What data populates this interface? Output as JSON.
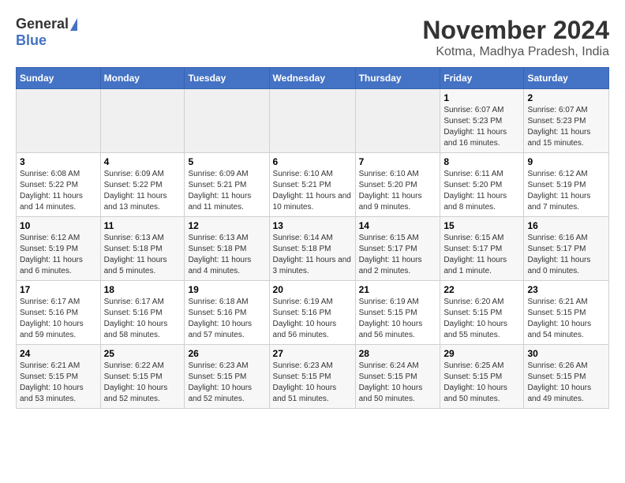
{
  "logo": {
    "general": "General",
    "blue": "Blue"
  },
  "title": "November 2024",
  "subtitle": "Kotma, Madhya Pradesh, India",
  "days_of_week": [
    "Sunday",
    "Monday",
    "Tuesday",
    "Wednesday",
    "Thursday",
    "Friday",
    "Saturday"
  ],
  "weeks": [
    [
      {
        "day": "",
        "info": ""
      },
      {
        "day": "",
        "info": ""
      },
      {
        "day": "",
        "info": ""
      },
      {
        "day": "",
        "info": ""
      },
      {
        "day": "",
        "info": ""
      },
      {
        "day": "1",
        "info": "Sunrise: 6:07 AM\nSunset: 5:23 PM\nDaylight: 11 hours and 16 minutes."
      },
      {
        "day": "2",
        "info": "Sunrise: 6:07 AM\nSunset: 5:23 PM\nDaylight: 11 hours and 15 minutes."
      }
    ],
    [
      {
        "day": "3",
        "info": "Sunrise: 6:08 AM\nSunset: 5:22 PM\nDaylight: 11 hours and 14 minutes."
      },
      {
        "day": "4",
        "info": "Sunrise: 6:09 AM\nSunset: 5:22 PM\nDaylight: 11 hours and 13 minutes."
      },
      {
        "day": "5",
        "info": "Sunrise: 6:09 AM\nSunset: 5:21 PM\nDaylight: 11 hours and 11 minutes."
      },
      {
        "day": "6",
        "info": "Sunrise: 6:10 AM\nSunset: 5:21 PM\nDaylight: 11 hours and 10 minutes."
      },
      {
        "day": "7",
        "info": "Sunrise: 6:10 AM\nSunset: 5:20 PM\nDaylight: 11 hours and 9 minutes."
      },
      {
        "day": "8",
        "info": "Sunrise: 6:11 AM\nSunset: 5:20 PM\nDaylight: 11 hours and 8 minutes."
      },
      {
        "day": "9",
        "info": "Sunrise: 6:12 AM\nSunset: 5:19 PM\nDaylight: 11 hours and 7 minutes."
      }
    ],
    [
      {
        "day": "10",
        "info": "Sunrise: 6:12 AM\nSunset: 5:19 PM\nDaylight: 11 hours and 6 minutes."
      },
      {
        "day": "11",
        "info": "Sunrise: 6:13 AM\nSunset: 5:18 PM\nDaylight: 11 hours and 5 minutes."
      },
      {
        "day": "12",
        "info": "Sunrise: 6:13 AM\nSunset: 5:18 PM\nDaylight: 11 hours and 4 minutes."
      },
      {
        "day": "13",
        "info": "Sunrise: 6:14 AM\nSunset: 5:18 PM\nDaylight: 11 hours and 3 minutes."
      },
      {
        "day": "14",
        "info": "Sunrise: 6:15 AM\nSunset: 5:17 PM\nDaylight: 11 hours and 2 minutes."
      },
      {
        "day": "15",
        "info": "Sunrise: 6:15 AM\nSunset: 5:17 PM\nDaylight: 11 hours and 1 minute."
      },
      {
        "day": "16",
        "info": "Sunrise: 6:16 AM\nSunset: 5:17 PM\nDaylight: 11 hours and 0 minutes."
      }
    ],
    [
      {
        "day": "17",
        "info": "Sunrise: 6:17 AM\nSunset: 5:16 PM\nDaylight: 10 hours and 59 minutes."
      },
      {
        "day": "18",
        "info": "Sunrise: 6:17 AM\nSunset: 5:16 PM\nDaylight: 10 hours and 58 minutes."
      },
      {
        "day": "19",
        "info": "Sunrise: 6:18 AM\nSunset: 5:16 PM\nDaylight: 10 hours and 57 minutes."
      },
      {
        "day": "20",
        "info": "Sunrise: 6:19 AM\nSunset: 5:16 PM\nDaylight: 10 hours and 56 minutes."
      },
      {
        "day": "21",
        "info": "Sunrise: 6:19 AM\nSunset: 5:15 PM\nDaylight: 10 hours and 56 minutes."
      },
      {
        "day": "22",
        "info": "Sunrise: 6:20 AM\nSunset: 5:15 PM\nDaylight: 10 hours and 55 minutes."
      },
      {
        "day": "23",
        "info": "Sunrise: 6:21 AM\nSunset: 5:15 PM\nDaylight: 10 hours and 54 minutes."
      }
    ],
    [
      {
        "day": "24",
        "info": "Sunrise: 6:21 AM\nSunset: 5:15 PM\nDaylight: 10 hours and 53 minutes."
      },
      {
        "day": "25",
        "info": "Sunrise: 6:22 AM\nSunset: 5:15 PM\nDaylight: 10 hours and 52 minutes."
      },
      {
        "day": "26",
        "info": "Sunrise: 6:23 AM\nSunset: 5:15 PM\nDaylight: 10 hours and 52 minutes."
      },
      {
        "day": "27",
        "info": "Sunrise: 6:23 AM\nSunset: 5:15 PM\nDaylight: 10 hours and 51 minutes."
      },
      {
        "day": "28",
        "info": "Sunrise: 6:24 AM\nSunset: 5:15 PM\nDaylight: 10 hours and 50 minutes."
      },
      {
        "day": "29",
        "info": "Sunrise: 6:25 AM\nSunset: 5:15 PM\nDaylight: 10 hours and 50 minutes."
      },
      {
        "day": "30",
        "info": "Sunrise: 6:26 AM\nSunset: 5:15 PM\nDaylight: 10 hours and 49 minutes."
      }
    ]
  ]
}
